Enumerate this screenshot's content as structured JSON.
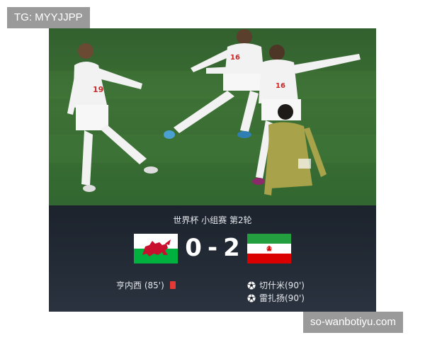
{
  "watermarks": {
    "top": "TG: MYYJJPP",
    "bottom": "so-wanbotiyu.com"
  },
  "photo": {
    "jersey_numbers": [
      "19",
      "16",
      "16"
    ],
    "description_icon": "celebration-photo"
  },
  "match": {
    "stage": "世界杯 小组赛 第2轮",
    "home_score": "0",
    "separator": "-",
    "away_score": "2",
    "home_flag_icon": "wales-flag-icon",
    "away_flag_icon": "iran-flag-icon",
    "home_events": [
      {
        "text": "亨内西 (85')",
        "icon": "red-card-icon"
      }
    ],
    "away_events": [
      {
        "text": "切什米(90')",
        "icon": "soccer-ball-icon"
      },
      {
        "text": "雷扎扬(90')",
        "icon": "soccer-ball-icon"
      }
    ]
  },
  "colors": {
    "pitch": "#3f7336",
    "scoreboard_bg": "#232b36",
    "red_card": "#e53935",
    "wales_green": "#00b140",
    "wales_red": "#c8102e",
    "iran_green": "#239f40",
    "iran_red": "#da0000"
  }
}
